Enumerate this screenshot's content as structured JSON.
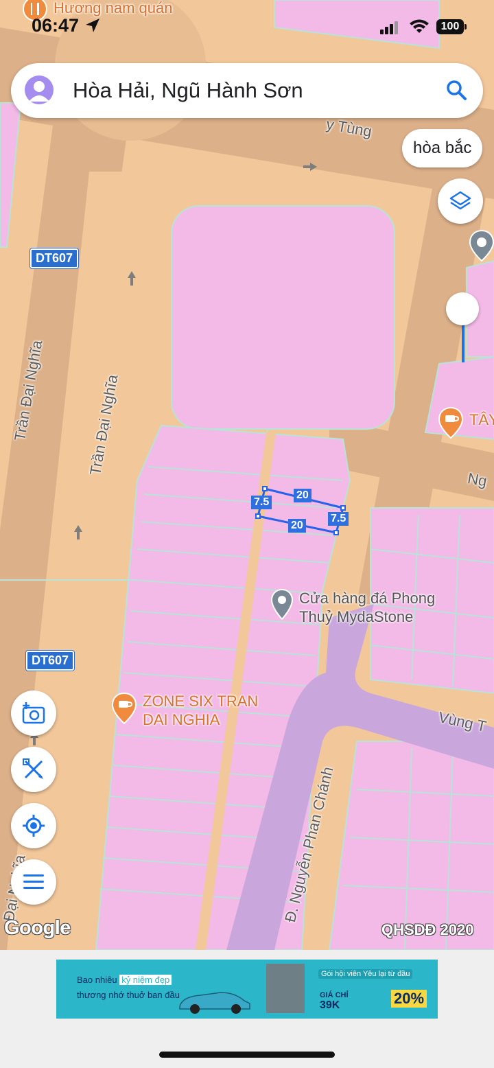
{
  "status_bar": {
    "time": "06:47",
    "battery": "100",
    "top_place": "Hương nam quán"
  },
  "search": {
    "query": "Hòa Hải, Ngũ Hành Sơn"
  },
  "suggestion_chip": "hòa bắc",
  "map": {
    "route_shield_1": "DT607",
    "route_shield_2": "DT607",
    "road_labels": {
      "tran_dai_nghia_left": "Trần Đại Nghĩa",
      "tran_dai_nghia_right": "Trần Đại Nghĩa",
      "tran_dai_nghia_bottom": "Đại Nghĩa",
      "vo_nguyen_partial": "y Tùng",
      "ng_partial": "Ng",
      "vung_partial": "Vùng T",
      "nguyen_phan_chanh": "Đ. Nguyễn Phan Chánh"
    },
    "measurements": {
      "top": "20",
      "bottom": "20",
      "left": "7.5",
      "right": "7.5"
    },
    "pois": {
      "stone_shop": "Cửa hàng đá Phong Thuỷ MydaStone",
      "stone_shop_line1": "Cửa hàng đá Phong",
      "stone_shop_line2": "Thuỷ MydaStone",
      "zone_six_line1": "ZONE SIX TRAN",
      "zone_six_line2": "DAI NGHIA",
      "tay_partial": "TÂY"
    },
    "attribution": "Google",
    "overlay_label": "QHSDĐ 2020"
  },
  "ad": {
    "line1_a": "Bao nhiêu",
    "line1_highlight": "kỷ niệm đẹp",
    "line2": "thương nhớ thuở ban đầu",
    "right_title": "Gói hội viên Yêu lại từ đầu",
    "price_label": "GIÁ CHỈ",
    "price": "39K",
    "discount": "20%"
  },
  "colors": {
    "land": "#f3b9e7",
    "road": "#f2c79a",
    "road_dark": "#ddb38a",
    "purple_road": "#c9a7dc",
    "accent_blue": "#1a73e8"
  }
}
